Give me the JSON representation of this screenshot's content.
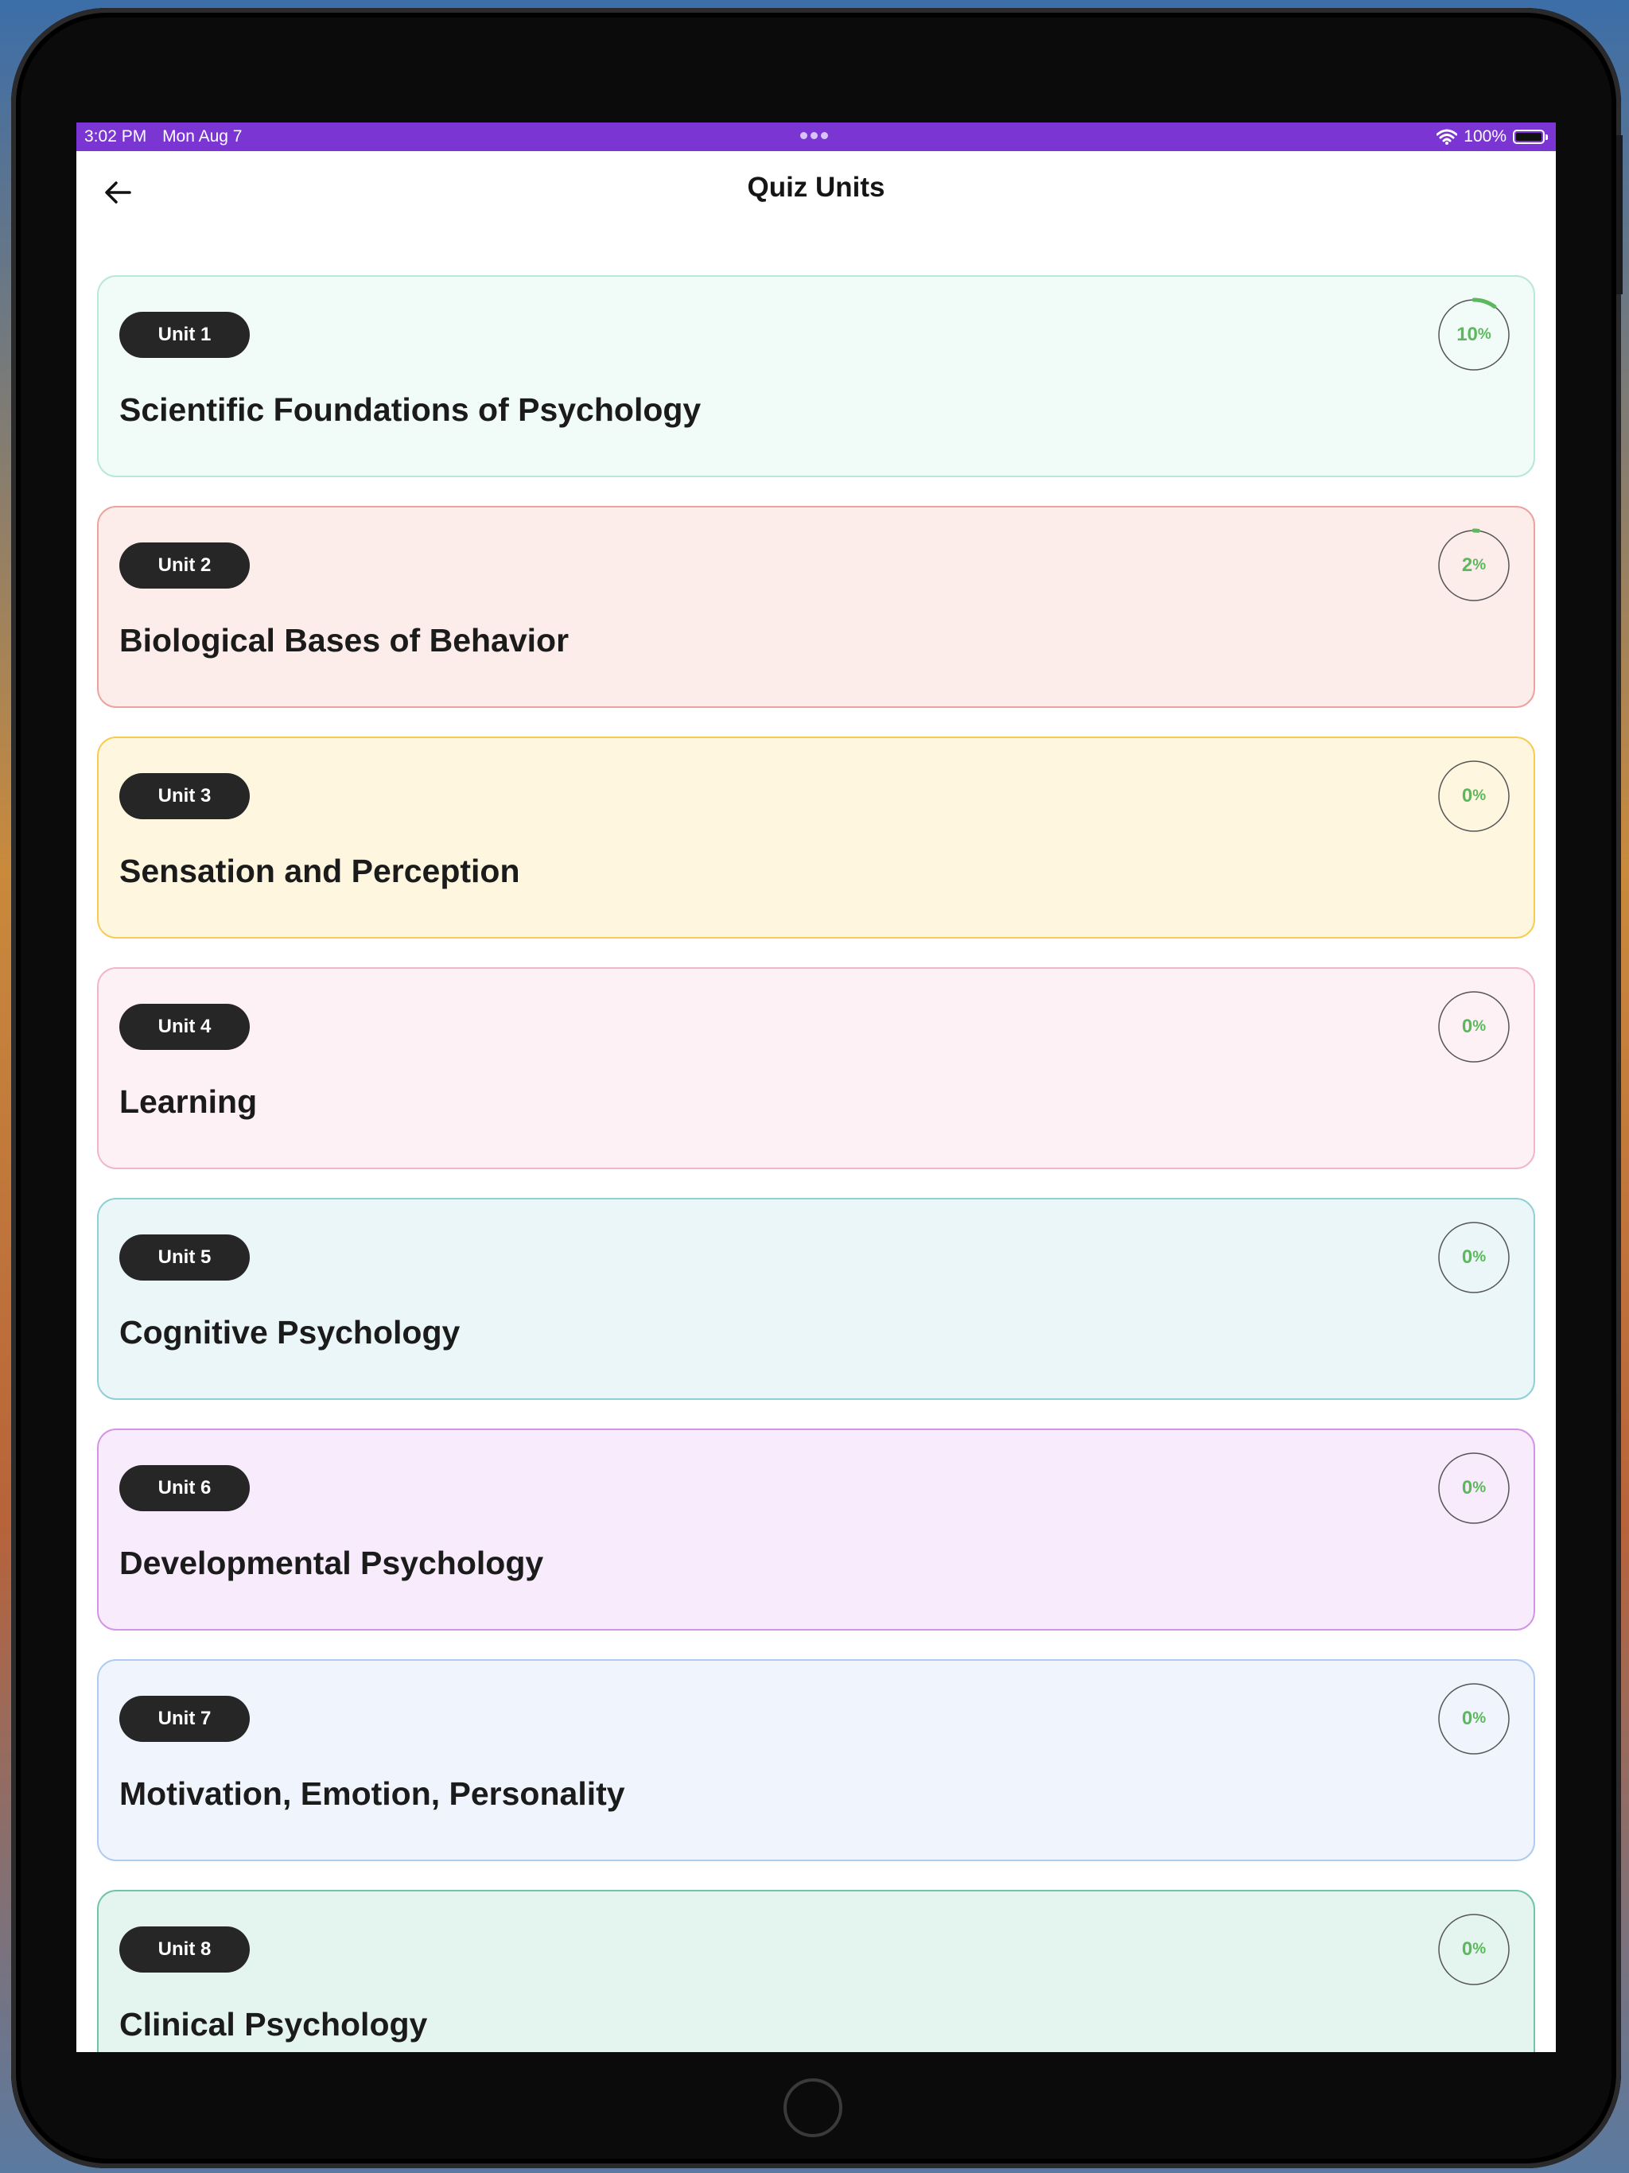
{
  "status_bar": {
    "time": "3:02 PM",
    "date": "Mon Aug 7",
    "battery": "100%",
    "icons": [
      "wifi-icon",
      "battery-icon"
    ]
  },
  "header": {
    "title": "Quiz Units",
    "back_icon": "arrow-left-icon"
  },
  "colors": {
    "status_bar": "#7a35d2",
    "progress": "#5cb85c",
    "ring_track": "#555555",
    "badge": "#262626"
  },
  "units": [
    {
      "badge": "Unit 1",
      "title": "Scientific Foundations of Psychology",
      "percent": "10",
      "progress": 0.1,
      "bg": "#f1fbf8",
      "border": "#b7e8db"
    },
    {
      "badge": "Unit 2",
      "title": "Biological Bases of Behavior",
      "percent": "2",
      "progress": 0.02,
      "bg": "#fcecea",
      "border": "#eda29c"
    },
    {
      "badge": "Unit 3",
      "title": "Sensation and Perception",
      "percent": "0",
      "progress": 0,
      "bg": "#fef6df",
      "border": "#f7cc52"
    },
    {
      "badge": "Unit 4",
      "title": "Learning",
      "percent": "0",
      "progress": 0,
      "bg": "#fdf1f5",
      "border": "#f1b6c9"
    },
    {
      "badge": "Unit 5",
      "title": "Cognitive Psychology",
      "percent": "0",
      "progress": 0,
      "bg": "#eaf6f7",
      "border": "#8fd0d6"
    },
    {
      "badge": "Unit 6",
      "title": "Developmental Psychology",
      "percent": "0",
      "progress": 0,
      "bg": "#f7ebfc",
      "border": "#d494e6"
    },
    {
      "badge": "Unit 7",
      "title": "Motivation, Emotion, Personality",
      "percent": "0",
      "progress": 0,
      "bg": "#eff4fd",
      "border": "#aecbf1"
    },
    {
      "badge": "Unit 8",
      "title": "Clinical Psychology",
      "percent": "0",
      "progress": 0,
      "bg": "#e4f4ef",
      "border": "#6fc6a6"
    }
  ]
}
